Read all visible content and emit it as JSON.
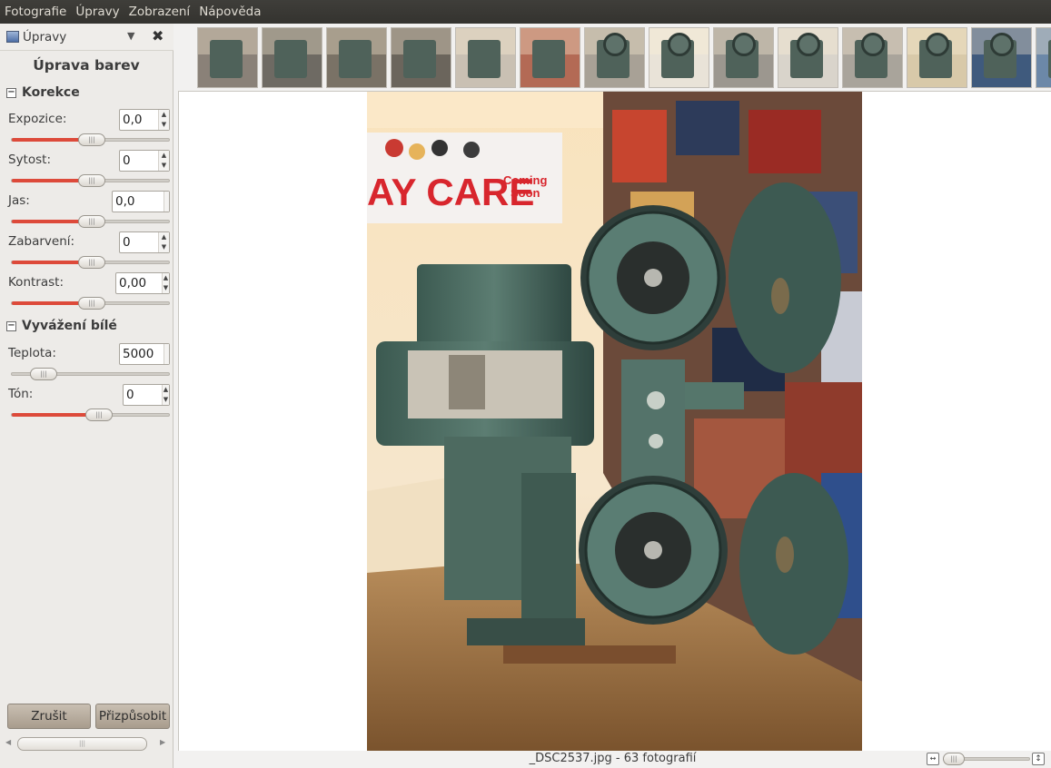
{
  "menubar": {
    "items": [
      "Fotografie",
      "Úpravy",
      "Zobrazení",
      "Nápověda"
    ]
  },
  "pane": {
    "title": "Úpravy",
    "icons": {
      "pane": "image-icon",
      "dropdown": "chevron-down-icon",
      "close": "close-icon"
    },
    "section_title": "Úprava barev",
    "groups": [
      {
        "title": "Korekce",
        "controls": [
          {
            "label": "Expozice:",
            "value": "0,0",
            "level": 0.5
          },
          {
            "label": "Sytost:",
            "value": "0",
            "level": 0.5
          },
          {
            "label": "Jas:",
            "value": "0,0",
            "level": 0.5
          },
          {
            "label": "Zabarvení:",
            "value": "0",
            "level": 0.5
          },
          {
            "label": "Kontrast:",
            "value": "0,00",
            "level": 0.5
          }
        ]
      },
      {
        "title": "Vyvážení bílé",
        "controls": [
          {
            "label": "Teplota:",
            "value": "5000",
            "level": 0.2
          },
          {
            "label": "Tón:",
            "value": "0",
            "level": 0.55
          }
        ]
      }
    ],
    "buttons": {
      "cancel": "Zrušit",
      "apply": "Přizpůsobit"
    }
  },
  "filmstrip": {
    "count_visible": 14,
    "palette": [
      "#8a8178",
      "#6e6a63",
      "#7a7266",
      "#6b655c",
      "#c9c0b3",
      "#b36a55",
      "#a8a196",
      "#e9e3d8",
      "#9c978f",
      "#d9d4cb",
      "#a9a49b",
      "#d8c9a9",
      "#3f5a7d",
      "#6c88a8"
    ]
  },
  "photo": {
    "poster_text_1": "AY CARE",
    "poster_text_2": "Coming",
    "poster_text_3": "Soon"
  },
  "status": {
    "text": "_DSC2537.jpg  -  63 fotografií"
  }
}
